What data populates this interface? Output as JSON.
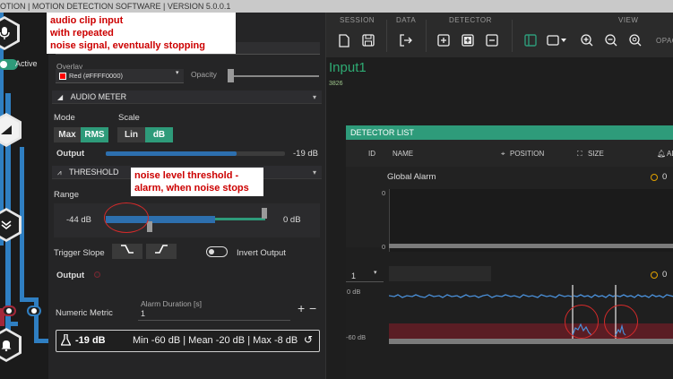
{
  "window": {
    "title": "OTION | MOTION DETECTION SOFTWARE | VERSION 5.0.0.1"
  },
  "graph": {
    "active_label": "Active"
  },
  "overlay": {
    "overlay_label": "Overlay",
    "overlay_value": "Red (#FFFF0000)",
    "overlay_color": "#ff0000",
    "opacity_label": "Opacity",
    "opacity_level": 0.02
  },
  "audio_meter": {
    "header": "AUDIO METER",
    "mode_label": "Mode",
    "scale_label": "Scale",
    "mode_options": [
      "Max",
      "RMS"
    ],
    "mode_selected": "RMS",
    "scale_options": [
      "Lin",
      "dB"
    ],
    "scale_selected": "dB",
    "output_label": "Output",
    "output_value": "-19 dB",
    "output_level": 0.73
  },
  "threshold": {
    "header": "THRESHOLD",
    "range_label": "Range",
    "range_min": "-44 dB",
    "range_max": "0 dB",
    "trigger_slope_label": "Trigger Slope",
    "invert_output_label": "Invert Output",
    "output_label": "Output"
  },
  "numeric_metric": {
    "label": "Numeric Metric",
    "alarm_duration_label": "Alarm Duration [s]",
    "alarm_duration_value": "1",
    "plus": "+",
    "minus": "−",
    "reading": "-19 dB",
    "stats": "Min -60 dB | Mean -20 dB | Max -8 dB"
  },
  "toolbar": {
    "groups": [
      "SESSION",
      "DATA",
      "DETECTOR",
      "VIEW"
    ],
    "truncated_label": "OPAC"
  },
  "input": {
    "title": "Input1",
    "sub": "3826"
  },
  "detector_list": {
    "header": "DETECTOR LIST",
    "columns": [
      "ID",
      "NAME",
      "POSITION",
      "SIZE",
      "AL"
    ],
    "rows": [
      {
        "name": "Global Alarm",
        "value": "0",
        "axis_top": "0",
        "axis_bottom": "0"
      },
      {
        "id": "1",
        "value": "0",
        "axis_top": "0 dB",
        "axis_bottom": "-60 dB"
      }
    ]
  },
  "annotations": {
    "audio_clip": "audio clip input\nwith repeated\nnoise signal, eventually stopping",
    "noise_threshold": "noise level threshold -\nalarm, when noise stops"
  },
  "colors": {
    "accent": "#2e9b7a",
    "wire_blue": "#2f7fc2",
    "wire_red": "#a3283a",
    "meter_blue": "#2d6fae",
    "annotation_red": "#cc0000"
  }
}
